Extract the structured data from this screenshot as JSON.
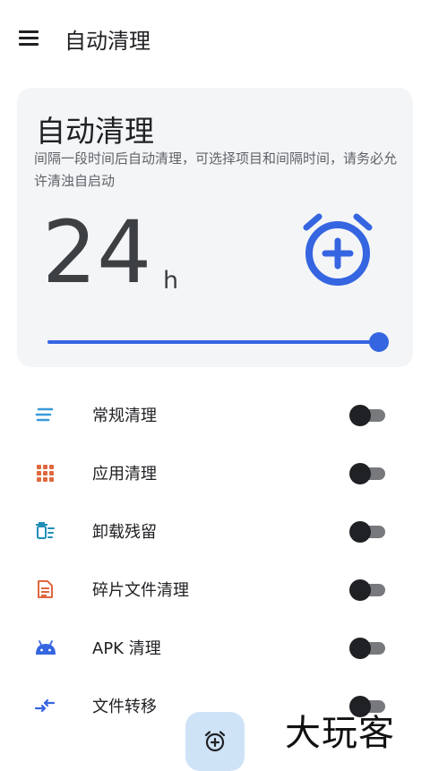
{
  "appbar": {
    "title": "自动清理",
    "menu_icon": "menu-icon"
  },
  "card": {
    "title": "自动清理",
    "description": "间隔一段时间后自动清理，可选择项目和间隔时间，请务必允许清浊自启动",
    "interval_value": "24",
    "interval_unit": "h",
    "slider_fraction": 1.0,
    "alarm_icon": "alarm-add-icon",
    "accent_color": "#3565e0"
  },
  "items": [
    {
      "label": "常规清理",
      "icon": "lines-icon",
      "icon_color": "#3a9ad9",
      "enabled": false
    },
    {
      "label": "应用清理",
      "icon": "grid-icon",
      "icon_color": "#e0683f",
      "enabled": false
    },
    {
      "label": "卸载残留",
      "icon": "trash-list-icon",
      "icon_color": "#1f8fb8",
      "enabled": false
    },
    {
      "label": "碎片文件清理",
      "icon": "document-icon",
      "icon_color": "#e0683f",
      "enabled": false
    },
    {
      "label": "APK 清理",
      "icon": "android-icon",
      "icon_color": "#3565e0",
      "enabled": false
    },
    {
      "label": "文件转移",
      "icon": "transfer-icon",
      "icon_color": "#3565e0",
      "enabled": false
    }
  ],
  "fab": {
    "icon": "alarm-add-icon"
  },
  "watermark": "大玩客"
}
